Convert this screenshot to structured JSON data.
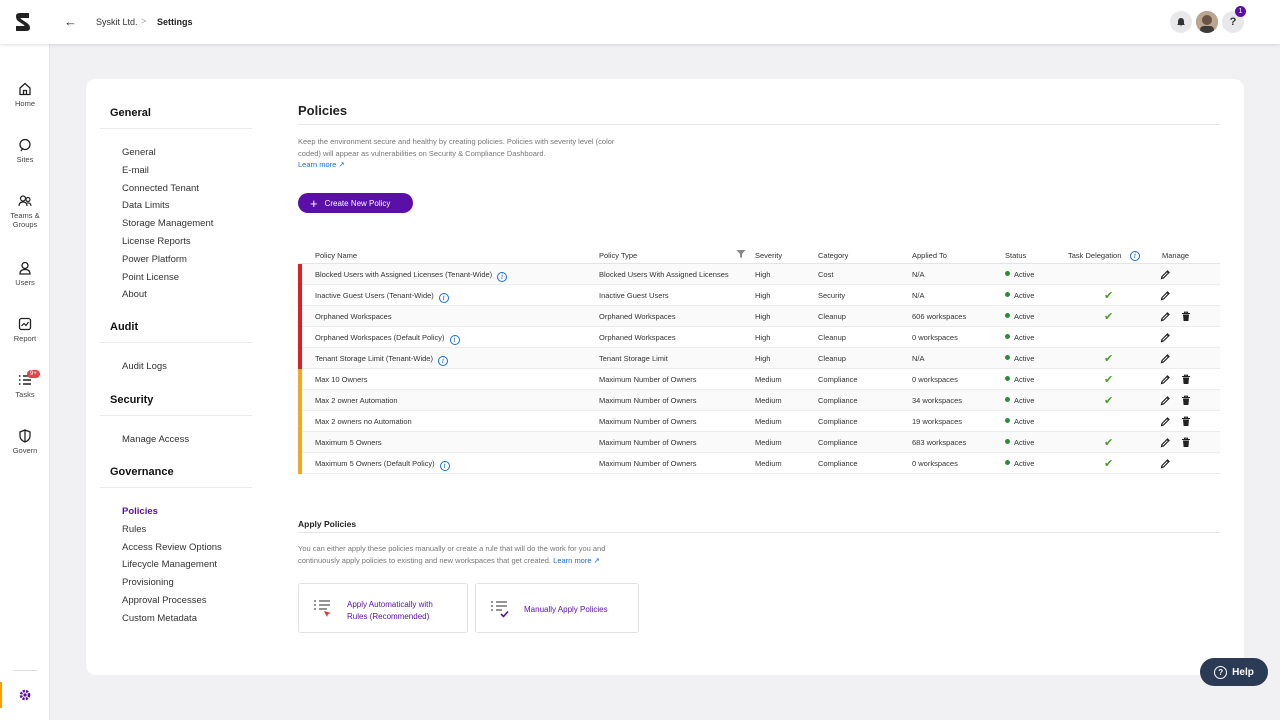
{
  "header": {
    "back_icon": "arrow-left-icon",
    "breadcrumb": [
      "Syskit Ltd.",
      "Settings"
    ],
    "separator": ">",
    "help_badge": "1",
    "help_glyph": "?"
  },
  "rail": {
    "items": [
      {
        "label": "Home",
        "icon": "home-icon"
      },
      {
        "label": "Sites",
        "icon": "sites-icon"
      },
      {
        "label": "Teams & Groups",
        "icon": "teams-icon"
      },
      {
        "label": "Users",
        "icon": "user-icon"
      },
      {
        "label": "Report",
        "icon": "report-icon"
      },
      {
        "label": "Tasks",
        "icon": "tasks-icon",
        "badge": "9+"
      },
      {
        "label": "Govern",
        "icon": "shield-icon"
      }
    ]
  },
  "settings_nav": {
    "sections": [
      {
        "title": "General",
        "items": [
          "General",
          "E-mail",
          "Connected Tenant",
          "Data Limits",
          "Storage Management",
          "License Reports",
          "Power Platform",
          "Point License",
          "About"
        ]
      },
      {
        "title": "Audit",
        "items": [
          "Audit Logs"
        ]
      },
      {
        "title": "Security",
        "items": [
          "Manage Access"
        ]
      },
      {
        "title": "Governance",
        "items": [
          "Policies",
          "Rules",
          "Access Review Options",
          "Lifecycle Management",
          "Provisioning",
          "Approval Processes",
          "Custom Metadata"
        ]
      }
    ],
    "active": "Policies"
  },
  "main": {
    "title": "Policies",
    "description": "Keep the environment secure and healthy by creating policies. Policies with severity level (color coded) will appear as vulnerabilities on Security & Compliance Dashboard.",
    "learn_more": "Learn more",
    "create_button": "Create New Policy"
  },
  "table": {
    "columns": [
      "Policy Name",
      "Policy Type",
      "Severity",
      "Category",
      "Applied To",
      "Status",
      "Task Delegation",
      "Manage"
    ],
    "severity_colors": {
      "High": "#e02020",
      "Medium": "#f5a623"
    },
    "rows": [
      {
        "name": "Blocked Users with Assigned Licenses (Tenant-Wide)",
        "info": true,
        "type": "Blocked Users With Assigned Licenses",
        "severity": "High",
        "category": "Cost",
        "applied": "N/A",
        "status": "Active",
        "delegation": false,
        "delete": false
      },
      {
        "name": "Inactive Guest Users (Tenant-Wide)",
        "info": true,
        "type": "Inactive Guest Users",
        "severity": "High",
        "category": "Security",
        "applied": "N/A",
        "status": "Active",
        "delegation": true,
        "delete": false
      },
      {
        "name": "Orphaned Workspaces",
        "info": false,
        "type": "Orphaned Workspaces",
        "severity": "High",
        "category": "Cleanup",
        "applied": "606 workspaces",
        "status": "Active",
        "delegation": true,
        "delete": true
      },
      {
        "name": "Orphaned Workspaces (Default Policy)",
        "info": true,
        "type": "Orphaned Workspaces",
        "severity": "High",
        "category": "Cleanup",
        "applied": "0 workspaces",
        "status": "Active",
        "delegation": false,
        "delete": false
      },
      {
        "name": "Tenant Storage Limit (Tenant-Wide)",
        "info": true,
        "type": "Tenant Storage Limit",
        "severity": "High",
        "category": "Cleanup",
        "applied": "N/A",
        "status": "Active",
        "delegation": true,
        "delete": false
      },
      {
        "name": "Max 10 Owners",
        "info": false,
        "type": "Maximum Number of Owners",
        "severity": "Medium",
        "category": "Compliance",
        "applied": "0 workspaces",
        "status": "Active",
        "delegation": true,
        "delete": true
      },
      {
        "name": "Max 2 owner Automation",
        "info": false,
        "type": "Maximum Number of Owners",
        "severity": "Medium",
        "category": "Compliance",
        "applied": "34 workspaces",
        "status": "Active",
        "delegation": true,
        "delete": true
      },
      {
        "name": "Max 2 owners no Automation",
        "info": false,
        "type": "Maximum Number of Owners",
        "severity": "Medium",
        "category": "Compliance",
        "applied": "19 workspaces",
        "status": "Active",
        "delegation": false,
        "delete": true
      },
      {
        "name": "Maximum 5 Owners",
        "info": false,
        "type": "Maximum Number of Owners",
        "severity": "Medium",
        "category": "Compliance",
        "applied": "683 workspaces",
        "status": "Active",
        "delegation": true,
        "delete": true
      },
      {
        "name": "Maximum 5 Owners (Default Policy)",
        "info": true,
        "type": "Maximum Number of Owners",
        "severity": "Medium",
        "category": "Compliance",
        "applied": "0 workspaces",
        "status": "Active",
        "delegation": true,
        "delete": false
      }
    ]
  },
  "apply": {
    "title": "Apply Policies",
    "description": "You can either apply these policies manually or create a rule that will do the work for you and continuously apply policies to existing and new workspaces that get created.",
    "learn_more": "Learn more",
    "auto_line1": "Apply Automatically with",
    "auto_line2": "Rules (Recommended)",
    "manual": "Manually Apply Policies"
  },
  "help_button": "Help",
  "colors": {
    "accent": "#5a0fa8",
    "link": "#1a6dd6",
    "active_status": "#2e8b3a"
  }
}
